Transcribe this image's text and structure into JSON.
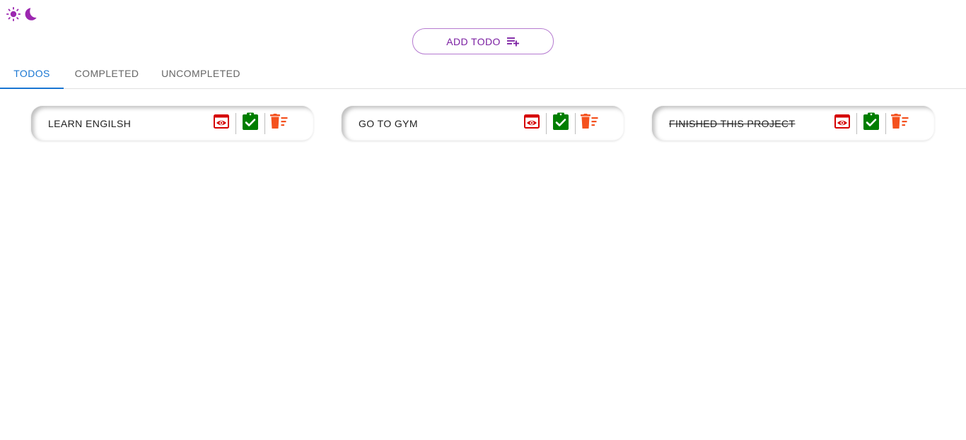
{
  "theme_toggle": {
    "sun_icon": "sun-icon",
    "moon_icon": "moon-icon",
    "color": "#9c27b0"
  },
  "add_button": {
    "label": "ADD TODO",
    "icon": "playlist-add-icon",
    "color": "#7b1fa2"
  },
  "tabs": [
    {
      "label": "TODOS",
      "active": true
    },
    {
      "label": "COMPLETED",
      "active": false
    },
    {
      "label": "UNCOMPLETED",
      "active": false
    }
  ],
  "colors": {
    "active_tab": "#1976d2",
    "view": "#d50000",
    "complete": "#007e00",
    "delete": "#f4511e"
  },
  "todos": [
    {
      "title": "LEARN ENGILSH",
      "completed": false
    },
    {
      "title": "GO TO GYM",
      "completed": false
    },
    {
      "title": "FINISHED THIS PROJECT",
      "completed": true
    }
  ],
  "action_icons": {
    "view": "eye-icon",
    "complete": "clipboard-check-icon",
    "delete": "delete-sweep-icon"
  }
}
